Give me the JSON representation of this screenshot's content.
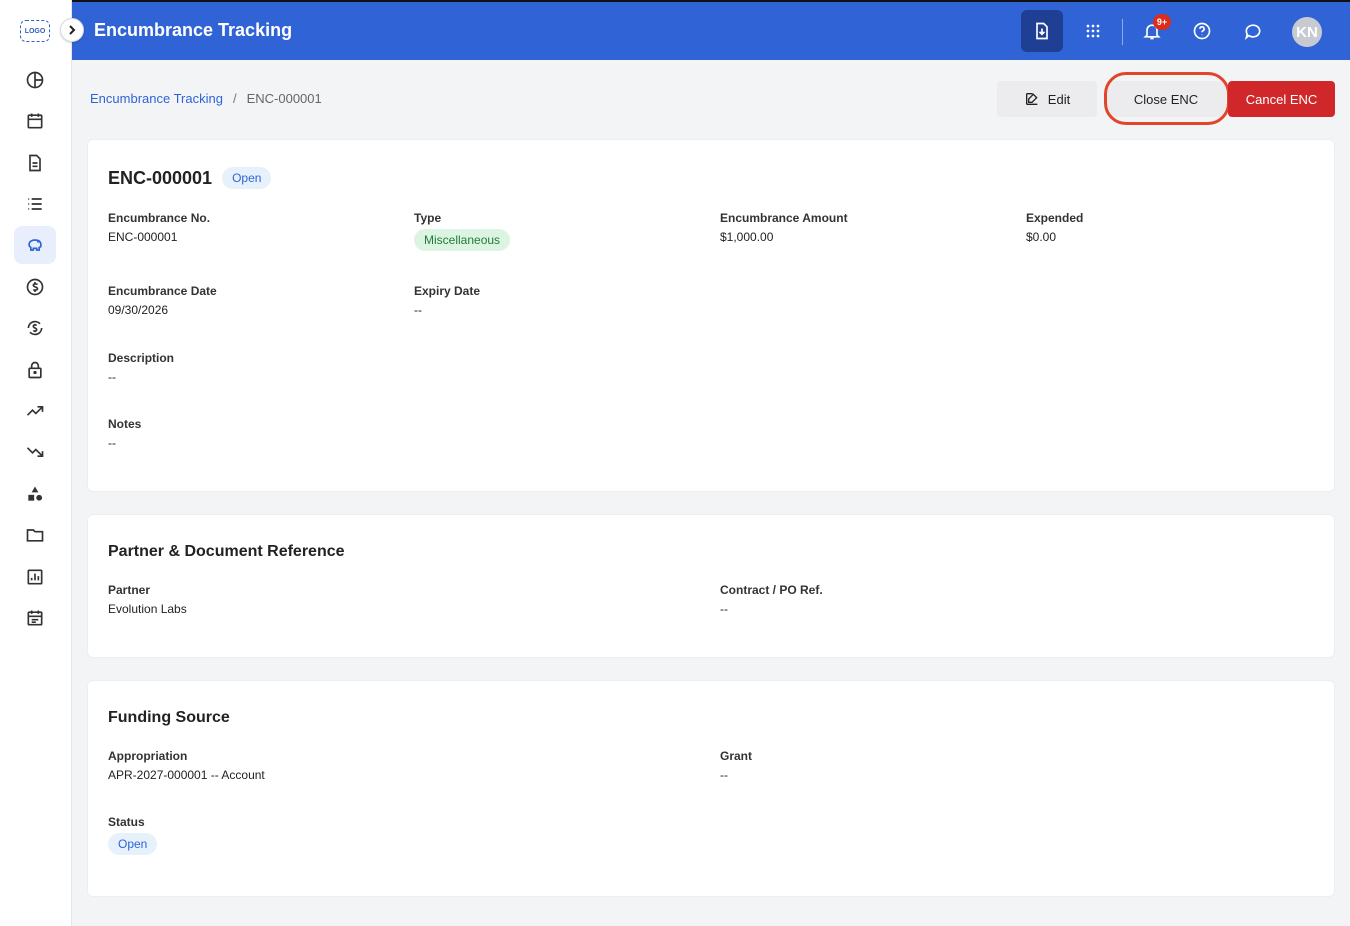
{
  "app": {
    "logo_text": "LOGO",
    "title": "Encumbrance Tracking",
    "avatar_initials": "KN",
    "notif_badge": "9+"
  },
  "sidebar": {
    "items": [
      {
        "icon": "pie-chart-icon"
      },
      {
        "icon": "calendar-icon"
      },
      {
        "icon": "document-icon"
      },
      {
        "icon": "list-icon"
      },
      {
        "icon": "piggy-bank-icon",
        "active": true
      },
      {
        "icon": "dollar-circle-icon"
      },
      {
        "icon": "currency-exchange-icon"
      },
      {
        "icon": "lock-icon"
      },
      {
        "icon": "trending-up-icon"
      },
      {
        "icon": "trending-down-icon"
      },
      {
        "icon": "shapes-icon"
      },
      {
        "icon": "folder-icon"
      },
      {
        "icon": "bar-chart-icon"
      },
      {
        "icon": "schedule-icon"
      }
    ]
  },
  "breadcrumb": {
    "parent": "Encumbrance Tracking",
    "separator": "/",
    "current": "ENC-000001"
  },
  "actions": {
    "edit": "Edit",
    "close": "Close ENC",
    "cancel": "Cancel ENC"
  },
  "details": {
    "heading": "ENC-000001",
    "status_pill": "Open",
    "fields": {
      "enc_no": {
        "label": "Encumbrance No.",
        "value": "ENC-000001"
      },
      "type": {
        "label": "Type",
        "value": "Miscellaneous"
      },
      "amount": {
        "label": "Encumbrance Amount",
        "value": "$1,000.00"
      },
      "expended": {
        "label": "Expended",
        "value": "$0.00"
      },
      "enc_date": {
        "label": "Encumbrance Date",
        "value": "09/30/2026"
      },
      "expiry": {
        "label": "Expiry Date",
        "value": "--"
      },
      "description": {
        "label": "Description",
        "value": "--"
      },
      "notes": {
        "label": "Notes",
        "value": "--"
      }
    }
  },
  "partner_section": {
    "title": "Partner & Document Reference",
    "partner": {
      "label": "Partner",
      "value": "Evolution Labs"
    },
    "contract": {
      "label": "Contract / PO Ref.",
      "value": "--"
    }
  },
  "funding_section": {
    "title": "Funding Source",
    "appropriation": {
      "label": "Appropriation",
      "value": "APR-2027-000001 -- Account"
    },
    "grant": {
      "label": "Grant",
      "value": "--"
    },
    "status": {
      "label": "Status",
      "value": "Open"
    }
  },
  "colors": {
    "primary": "#2f63d6",
    "danger": "#d0282a",
    "highlight": "#e2452b"
  }
}
